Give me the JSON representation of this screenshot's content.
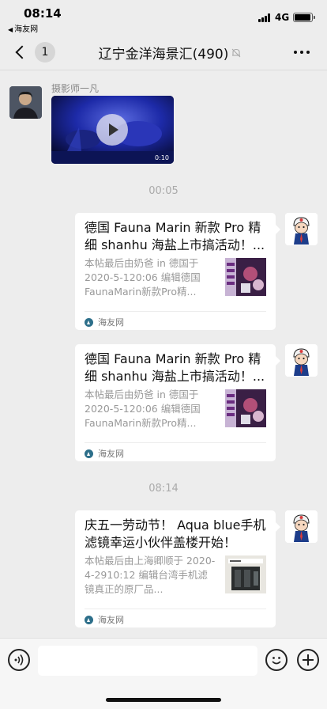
{
  "status_bar": {
    "time": "08:14",
    "back_app": "海友网",
    "network": "4G"
  },
  "nav": {
    "back_count": "1",
    "title": "辽宁金洋海景汇(490)"
  },
  "messages": {
    "video_message": {
      "sender": "摄影师一凡",
      "duration": "0:10"
    },
    "timestamp_1": "00:05",
    "card_1": {
      "title": "德国 Fauna Marin 新款 Pro 精细 shanhu 海盐上市搞活动！...",
      "desc": "本帖最后由奶爸 in 德国于 2020-5-120:06 编辑德国 FaunaMarin新款Pro精...",
      "source": "海友网"
    },
    "card_2": {
      "title": "德国 Fauna Marin 新款 Pro 精细 shanhu 海盐上市搞活动！...",
      "desc": "本帖最后由奶爸 in 德国于 2020-5-120:06 编辑德国 FaunaMarin新款Pro精...",
      "source": "海友网"
    },
    "timestamp_2": "08:14",
    "card_3": {
      "title": "庆五一劳动节！ Aqua blue手机滤镜幸运小伙伴盖楼开始！",
      "desc": "本帖最后由上海卿顺于 2020-4-2910:12 编辑台湾手机滤镜真正的原厂品...",
      "source": "海友网"
    }
  },
  "colors": {
    "background": "#ededed",
    "card": "#ffffff",
    "muted_text": "#999999"
  }
}
